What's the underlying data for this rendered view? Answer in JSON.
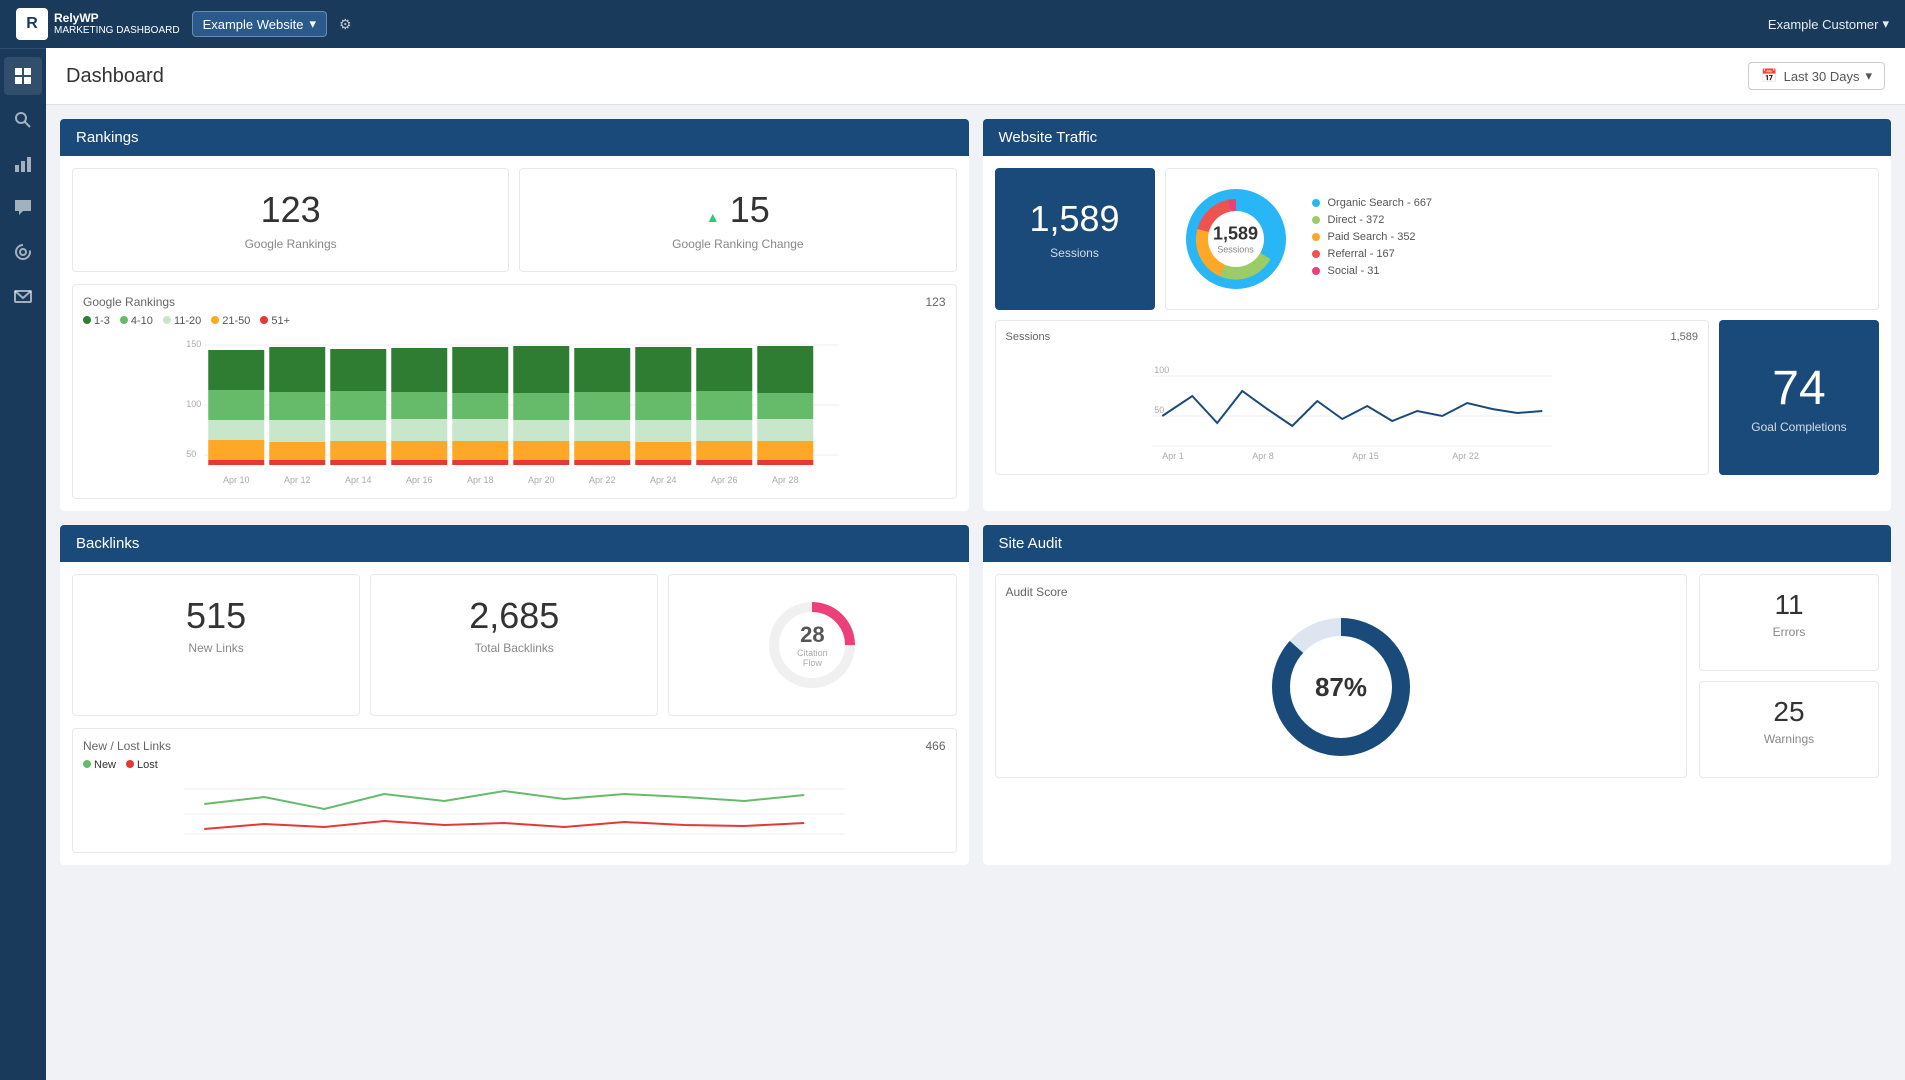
{
  "app": {
    "name": "RelyWP",
    "tagline": "MARKETING DASHBOARD"
  },
  "header": {
    "website": "Example Website",
    "title": "Dashboard",
    "dateRange": "Last 30 Days",
    "customer": "Example Customer"
  },
  "sidebar": {
    "items": [
      {
        "name": "dashboard",
        "icon": "⊞",
        "active": true
      },
      {
        "name": "search",
        "icon": "🔍",
        "active": false
      },
      {
        "name": "bar-chart",
        "icon": "📊",
        "active": false
      },
      {
        "name": "chat",
        "icon": "💬",
        "active": false
      },
      {
        "name": "at-sign",
        "icon": "@",
        "active": false
      },
      {
        "name": "mail",
        "icon": "✉",
        "active": false
      }
    ]
  },
  "rankings": {
    "title": "Rankings",
    "googleRankings": {
      "value": "123",
      "label": "Google Rankings"
    },
    "rankingChange": {
      "value": "15",
      "label": "Google Ranking Change"
    },
    "chart": {
      "title": "Google Rankings",
      "count": "123",
      "legend": [
        {
          "label": "1-3",
          "color": "#2e7d32"
        },
        {
          "label": "4-10",
          "color": "#66bb6a"
        },
        {
          "label": "11-20",
          "color": "#c8e6c9"
        },
        {
          "label": "21-50",
          "color": "#ffa726"
        },
        {
          "label": "51+",
          "color": "#e53935"
        }
      ],
      "xLabels": [
        "Apr 10",
        "Apr 12",
        "Apr 14",
        "Apr 16",
        "Apr 18",
        "Apr 20",
        "Apr 22",
        "Apr 24",
        "Apr 26",
        "Apr 28"
      ],
      "yLabels": [
        "150",
        "100",
        "50"
      ]
    }
  },
  "traffic": {
    "title": "Website Traffic",
    "sessions": {
      "value": "1,589",
      "label": "Sessions"
    },
    "donut": {
      "center": "1,589",
      "centerLabel": "Sessions",
      "segments": [
        {
          "label": "Organic Search - 667",
          "color": "#29b6f6",
          "value": 667
        },
        {
          "label": "Direct - 372",
          "color": "#9ccc65",
          "value": 372
        },
        {
          "label": "Paid Search - 352",
          "color": "#ffa726",
          "value": 352
        },
        {
          "label": "Referral - 167",
          "color": "#ef5350",
          "value": 167
        },
        {
          "label": "Social - 31",
          "color": "#ec407a",
          "value": 31
        }
      ]
    },
    "lineChart": {
      "title": "Sessions",
      "count": "1,589",
      "yMax": 100,
      "yMid": 50,
      "xLabels": [
        "Apr 1",
        "Apr 8",
        "Apr 15",
        "Apr 22"
      ]
    },
    "goalCompletions": {
      "value": "74",
      "label": "Goal Completions"
    }
  },
  "backlinks": {
    "title": "Backlinks",
    "newLinks": {
      "value": "515",
      "label": "New Links"
    },
    "totalBacklinks": {
      "value": "2,685",
      "label": "Total Backlinks"
    },
    "citationFlow": {
      "value": "28",
      "label": "Citation Flow"
    },
    "newLostChart": {
      "title": "New / Lost Links",
      "count": "466",
      "legend": [
        {
          "label": "New",
          "color": "#66bb6a"
        },
        {
          "label": "Lost",
          "color": "#e53935"
        }
      ]
    }
  },
  "siteAudit": {
    "title": "Site Audit",
    "auditScore": {
      "title": "Audit Score",
      "value": "87",
      "unit": "%"
    },
    "errors": {
      "value": "11",
      "label": "Errors"
    },
    "warnings": {
      "value": "25",
      "label": "Warnings"
    }
  }
}
